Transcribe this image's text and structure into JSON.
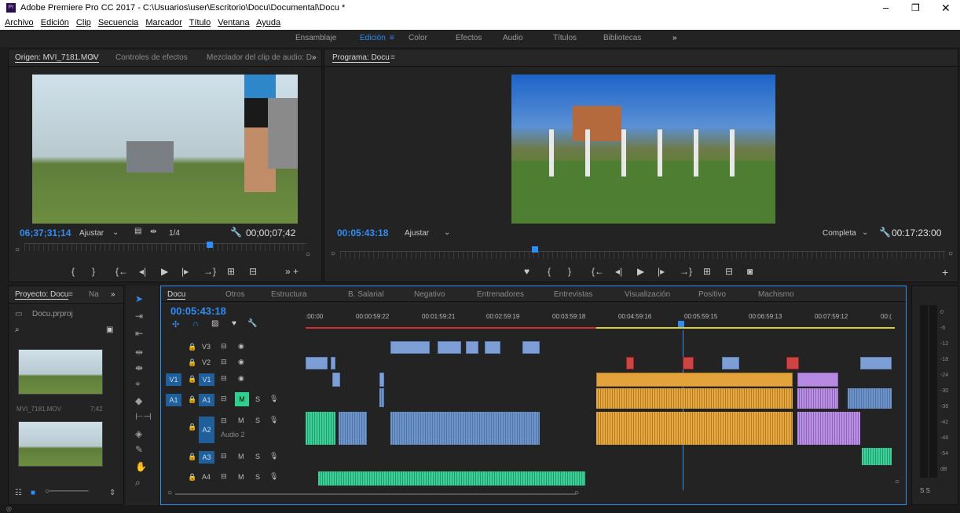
{
  "window": {
    "title": "Adobe Premiere Pro CC 2017 - C:\\Usuarios\\user\\Escritorio\\Docu\\Documental\\Docu *",
    "app_icon": "Pr"
  },
  "menu": [
    "Archivo",
    "Edición",
    "Clip",
    "Secuencia",
    "Marcador",
    "Título",
    "Ventana",
    "Ayuda"
  ],
  "workspaces": {
    "items": [
      "Ensamblaje",
      "Edición",
      "Color",
      "Efectos",
      "Audio",
      "Títulos",
      "Bibliotecas"
    ],
    "active": "Edición",
    "more": "»"
  },
  "source": {
    "tabs": [
      "Origen: MVI_7181.MOV",
      "Controles de efectos",
      "Mezclador del clip de audio: D"
    ],
    "timecode": "06;37;31;14",
    "fit": "Ajustar",
    "resolution": "1/4",
    "duration": "00;00;07;42"
  },
  "program": {
    "tab": "Programa: Docu",
    "timecode": "00:05:43:18",
    "fit": "Ajustar",
    "quality": "Completa",
    "duration": "00:17:23:00"
  },
  "project": {
    "tabs": [
      "Proyecto: Docu",
      "Na"
    ],
    "file": "Docu.prproj",
    "clip_name": "MVI_7181.MOV",
    "clip_dur": "7;42"
  },
  "timeline": {
    "tabs": [
      "Docu",
      "Otros",
      "Estructura",
      "B. Salarial",
      "Negativo",
      "Entrenadores",
      "Entrevistas",
      "Visualización",
      "Positivo",
      "Machismo"
    ],
    "timecode": "00:05:43:18",
    "ruler": [
      ":00:00",
      "00:00:59:22",
      "00:01:59:21",
      "00:02:59:19",
      "00:03:59:18",
      "00:04:59:16",
      "00:05:59:15",
      "00:06:59:13",
      "00:07:59:12",
      "00:("
    ],
    "tracks": [
      {
        "id": "V3",
        "kind": "video"
      },
      {
        "id": "V2",
        "kind": "video"
      },
      {
        "id": "V1",
        "kind": "video",
        "src": "V1"
      },
      {
        "id": "A1",
        "kind": "audio",
        "src": "A1"
      },
      {
        "id": "A2",
        "kind": "audio",
        "name": "Audio 2"
      },
      {
        "id": "A3",
        "kind": "audio"
      },
      {
        "id": "A4",
        "kind": "audio"
      }
    ],
    "mute": "M",
    "solo": "S"
  },
  "meter": {
    "scale": [
      "0",
      "-6",
      "-12",
      "-18",
      "-24",
      "-30",
      "-36",
      "-42",
      "-48",
      "-54",
      "dB"
    ],
    "solo": "S  S"
  }
}
